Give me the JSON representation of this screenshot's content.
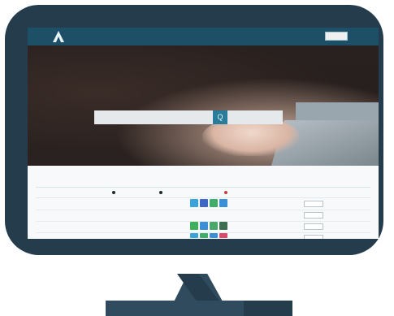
{
  "colors": {
    "bezel": "#243c4c",
    "nav": "#1d4f66",
    "accent": "#2a7d9a",
    "stand": "#2f4b5d"
  },
  "nav": {
    "logo_text": "",
    "items": [
      {
        "label": ""
      },
      {
        "label": ""
      },
      {
        "label": ""
      },
      {
        "label": ""
      }
    ],
    "right_text": "",
    "login_label": ""
  },
  "search": {
    "value": "",
    "placeholder": "",
    "suggestion": "",
    "button_icon": "search-icon",
    "button_glyph": "Q"
  },
  "section": {
    "title": "",
    "subtitle": ""
  },
  "table": {
    "headers": [
      "",
      "",
      "",
      ""
    ],
    "rows": [
      {
        "c1": "",
        "c2": "",
        "c3": "",
        "action": ""
      },
      {
        "c1": "",
        "c2": "",
        "c3": "",
        "action": ""
      },
      {
        "c1": "",
        "c2": "",
        "c3": "",
        "action": ""
      },
      {
        "c1": "",
        "c2": "",
        "c3": "",
        "action": ""
      }
    ]
  }
}
